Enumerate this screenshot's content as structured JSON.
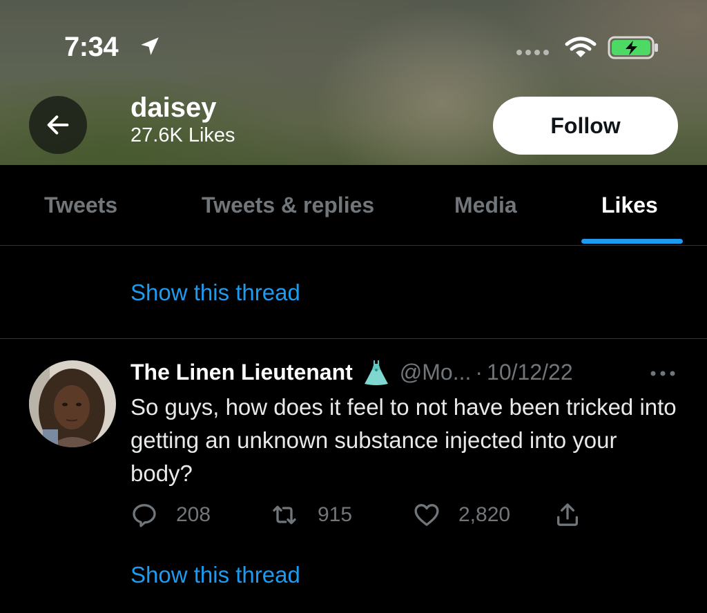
{
  "status_bar": {
    "time": "7:34"
  },
  "header": {
    "name": "daisey",
    "likes_count": "27.6K Likes",
    "follow_label": "Follow"
  },
  "tabs": [
    {
      "label": "Tweets",
      "active": false
    },
    {
      "label": "Tweets & replies",
      "active": false
    },
    {
      "label": "Media",
      "active": false
    },
    {
      "label": "Likes",
      "active": true
    }
  ],
  "feed": {
    "top_show_thread": "Show this thread",
    "tweet": {
      "author_name": "The Linen Lieutenant",
      "author_emoji": "dress-icon",
      "handle": "@Mo...",
      "separator": "·",
      "date": "10/12/22",
      "text": "So guys, how does it feel to not have been tricked into getting an unknown substance injected into your body?",
      "replies": "208",
      "retweets": "915",
      "likes": "2,820",
      "show_thread": "Show this thread"
    }
  },
  "colors": {
    "accent": "#1d9bf0",
    "background": "#000000",
    "secondary_text": "#71767b",
    "divider": "#2f3336",
    "battery": "#4cd964"
  }
}
